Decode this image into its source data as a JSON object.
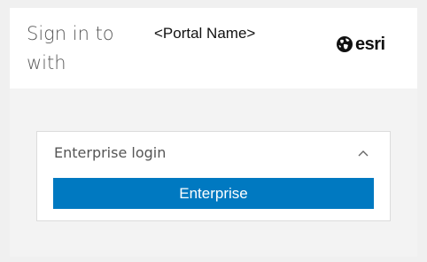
{
  "header": {
    "title": "Sign in to with",
    "portal_name": "<Portal Name>",
    "logo_text": "esri",
    "logo_icon": "globe-icon"
  },
  "login_panel": {
    "title": "Enterprise login",
    "collapse_icon": "chevron-up-icon",
    "expanded": true,
    "enterprise_button_label": "Enterprise"
  },
  "colors": {
    "accent": "#0079c1",
    "header_background": "#ffffff",
    "body_background": "#f3f3f3",
    "title_text": "#5a5a5a"
  }
}
